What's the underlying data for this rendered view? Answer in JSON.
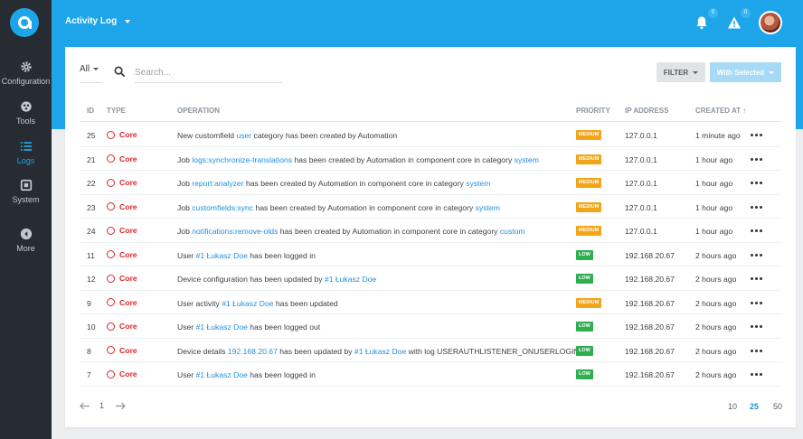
{
  "header": {
    "title": "Activity Log",
    "notifications_count": "0",
    "alerts_count": "0"
  },
  "sidebar": {
    "items": [
      {
        "label": "Configuration",
        "icon": "gear-icon"
      },
      {
        "label": "Tools",
        "icon": "tools-icon"
      },
      {
        "label": "Logs",
        "icon": "list-icon",
        "active": true
      },
      {
        "label": "System",
        "icon": "chip-icon"
      },
      {
        "label": "More",
        "icon": "arrow-left-circle-icon"
      }
    ]
  },
  "filters": {
    "scope": "All",
    "search_placeholder": "Search...",
    "filter_label": "FILTER",
    "with_selected_label": "With Selected"
  },
  "table": {
    "columns": [
      "ID",
      "TYPE",
      "OPERATION",
      "PRIORITY",
      "IP ADDRESS",
      "CREATED AT ↑"
    ],
    "rows": [
      {
        "id": "25",
        "type": "Core",
        "op": [
          {
            "t": "New customfield "
          },
          {
            "t": "user",
            "link": true
          },
          {
            "t": " category has been created by Automation"
          }
        ],
        "priority": "MEDIUM",
        "ip": "127.0.0.1",
        "created": "1 minute ago"
      },
      {
        "id": "21",
        "type": "Core",
        "op": [
          {
            "t": "Job "
          },
          {
            "t": "logs:synchronize-translations",
            "link": true
          },
          {
            "t": " has been created by Automation in component core in category "
          },
          {
            "t": "system",
            "link": true
          }
        ],
        "priority": "MEDIUM",
        "ip": "127.0.0.1",
        "created": "1 hour ago"
      },
      {
        "id": "22",
        "type": "Core",
        "op": [
          {
            "t": "Job "
          },
          {
            "t": "report:analyzer",
            "link": true
          },
          {
            "t": " has been created by Automation in component core in category "
          },
          {
            "t": "system",
            "link": true
          }
        ],
        "priority": "MEDIUM",
        "ip": "127.0.0.1",
        "created": "1 hour ago"
      },
      {
        "id": "23",
        "type": "Core",
        "op": [
          {
            "t": "Job "
          },
          {
            "t": "customfields:sync",
            "link": true
          },
          {
            "t": " has been created by Automation in component core in category "
          },
          {
            "t": "system",
            "link": true
          }
        ],
        "priority": "MEDIUM",
        "ip": "127.0.0.1",
        "created": "1 hour ago"
      },
      {
        "id": "24",
        "type": "Core",
        "op": [
          {
            "t": "Job "
          },
          {
            "t": "notifications:remove-olds",
            "link": true
          },
          {
            "t": " has been created by Automation in component core in category "
          },
          {
            "t": "custom",
            "link": true
          }
        ],
        "priority": "MEDIUM",
        "ip": "127.0.0.1",
        "created": "1 hour ago"
      },
      {
        "id": "11",
        "type": "Core",
        "op": [
          {
            "t": "User "
          },
          {
            "t": "#1 Łukasz Doe",
            "link": true
          },
          {
            "t": " has been logged in"
          }
        ],
        "priority": "LOW",
        "ip": "192.168.20.67",
        "created": "2 hours ago"
      },
      {
        "id": "12",
        "type": "Core",
        "op": [
          {
            "t": "Device configuration has been updated by "
          },
          {
            "t": "#1 Łukasz Doe",
            "link": true
          }
        ],
        "priority": "LOW",
        "ip": "192.168.20.67",
        "created": "2 hours ago"
      },
      {
        "id": "9",
        "type": "Core",
        "op": [
          {
            "t": "User activity "
          },
          {
            "t": "#1 Łukasz Doe",
            "link": true
          },
          {
            "t": " has been updated"
          }
        ],
        "priority": "MEDIUM",
        "ip": "192.168.20.67",
        "created": "2 hours ago"
      },
      {
        "id": "10",
        "type": "Core",
        "op": [
          {
            "t": "User "
          },
          {
            "t": "#1 Łukasz Doe",
            "link": true
          },
          {
            "t": " has been logged out"
          }
        ],
        "priority": "LOW",
        "ip": "192.168.20.67",
        "created": "2 hours ago"
      },
      {
        "id": "8",
        "type": "Core",
        "op": [
          {
            "t": "Device details "
          },
          {
            "t": "192.168.20.67",
            "link": true
          },
          {
            "t": " has been updated by "
          },
          {
            "t": "#1 Łukasz Doe",
            "link": true
          },
          {
            "t": " with log USERAUTHLISTENER_ONUSERLOGIN"
          }
        ],
        "priority": "LOW",
        "ip": "192.168.20.67",
        "created": "2 hours ago"
      },
      {
        "id": "7",
        "type": "Core",
        "op": [
          {
            "t": "User "
          },
          {
            "t": "#1 Łukasz Doe",
            "link": true
          },
          {
            "t": " has been logged in"
          }
        ],
        "priority": "LOW",
        "ip": "192.168.20.67",
        "created": "2 hours ago"
      }
    ]
  },
  "pagination": {
    "current_page": "1",
    "per_page_options": [
      "10",
      "25",
      "50"
    ],
    "per_page_selected": "25"
  },
  "colors": {
    "brand": "#1ea5e9",
    "sidebar": "#272c33",
    "core_type": "#e02424",
    "priority_medium": "#f2a51a",
    "priority_low": "#2eae4f",
    "link": "#1e90e0"
  }
}
